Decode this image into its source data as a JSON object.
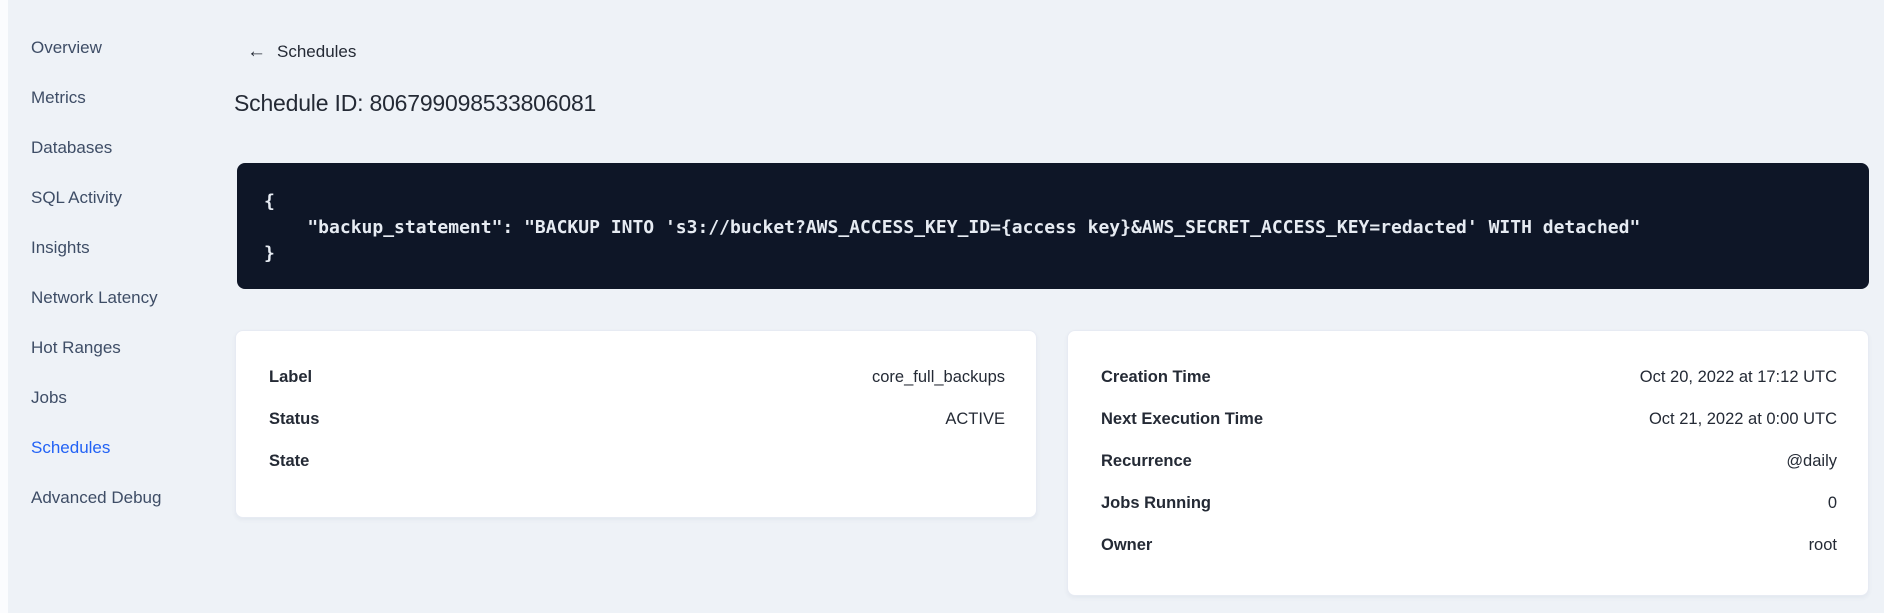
{
  "colors": {
    "page_bg": "#eef2f7",
    "left_strip_bg": "#fbfcfe",
    "code_bg": "#0e1627",
    "code_text": "#e6ebf2",
    "card_bg": "#ffffff",
    "nav_text": "#3e4d66",
    "nav_active": "#2262f5",
    "text_dark": "#242a35"
  },
  "sidebar": {
    "items": [
      {
        "name": "overview",
        "label": "Overview",
        "active": false
      },
      {
        "name": "metrics",
        "label": "Metrics",
        "active": false
      },
      {
        "name": "databases",
        "label": "Databases",
        "active": false
      },
      {
        "name": "sql-activity",
        "label": "SQL Activity",
        "active": false
      },
      {
        "name": "insights",
        "label": "Insights",
        "active": false
      },
      {
        "name": "network-latency",
        "label": "Network Latency",
        "active": false
      },
      {
        "name": "hot-ranges",
        "label": "Hot Ranges",
        "active": false
      },
      {
        "name": "jobs",
        "label": "Jobs",
        "active": false
      },
      {
        "name": "schedules",
        "label": "Schedules",
        "active": true
      },
      {
        "name": "advanced-debug",
        "label": "Advanced Debug",
        "active": false
      }
    ]
  },
  "header": {
    "back_icon_glyph": "←",
    "back_label": "Schedules",
    "title": "Schedule ID: 806799098533806081"
  },
  "code_block": {
    "text": "{\n    \"backup_statement\": \"BACKUP INTO 's3://bucket?AWS_ACCESS_KEY_ID={access key}&AWS_SECRET_ACCESS_KEY=redacted' WITH detached\"\n}"
  },
  "details_card": {
    "rows": [
      {
        "label": "Label",
        "value": "core_full_backups"
      },
      {
        "label": "Status",
        "value": "ACTIVE"
      },
      {
        "label": "State",
        "value": ""
      }
    ]
  },
  "schedule_card": {
    "rows": [
      {
        "label": "Creation Time",
        "value": "Oct 20, 2022 at 17:12 UTC"
      },
      {
        "label": "Next Execution Time",
        "value": "Oct 21, 2022 at 0:00 UTC"
      },
      {
        "label": "Recurrence",
        "value": "@daily"
      },
      {
        "label": "Jobs Running",
        "value": "0"
      },
      {
        "label": "Owner",
        "value": "root"
      }
    ]
  }
}
